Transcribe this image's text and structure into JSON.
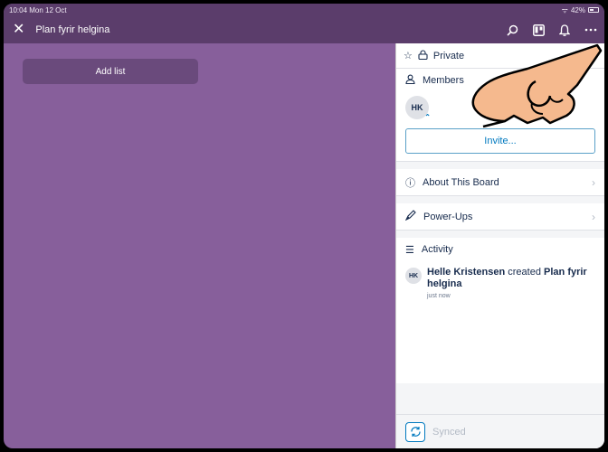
{
  "status_bar": {
    "time": "10:04",
    "date": "Mon 12 Oct",
    "battery": "42%"
  },
  "header": {
    "close_label": "✕",
    "board_title": "Plan fyrir helgina",
    "icons": [
      "search-icon",
      "board-icon",
      "bell-icon",
      "more-icon"
    ]
  },
  "canvas": {
    "add_list_label": "Add list"
  },
  "panel": {
    "visibility_label": "Private",
    "members_title": "Members",
    "member_initials": "HK",
    "invite_label": "Invite...",
    "about_label": "About This Board",
    "powerups_label": "Power-Ups",
    "activity_title": "Activity",
    "activity": [
      {
        "initials": "HK",
        "user": "Helle Kristensen",
        "action": "created",
        "target": "Plan fyrir helgina",
        "time": "just now"
      }
    ],
    "sync_status": "Synced"
  },
  "colors": {
    "board_bg": "#875f9b",
    "header_bg": "#5b3d6b",
    "accent": "#0079bf"
  }
}
